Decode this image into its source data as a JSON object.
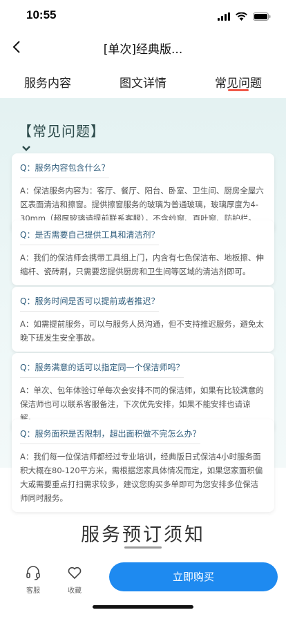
{
  "status": {
    "time": "10:55"
  },
  "nav": {
    "title": "[单次]经典版..."
  },
  "tabs": [
    {
      "label": "服务内容"
    },
    {
      "label": "图文详情"
    },
    {
      "label": "常见问题"
    }
  ],
  "section_title": "【常见问题】",
  "faqs": [
    {
      "q": "Q：服务内容包含什么？",
      "a": "A：保洁服务内容为：客厅、餐厅、阳台、卧室、卫生间、厨房全屋六区表面清洁和擦窗。提供擦窗服务的玻璃为普通玻璃，玻璃厚度为4-30mm（超厚玻璃请提前联系客服），不含纱窗、百叶窗、防护栏。"
    },
    {
      "q": "Q：是否需要自己提供工具和清洁剂？",
      "a": "A：我们的保洁师会携带工具组上门，内含有七色保洁布、地板擦、伸缩杆、瓷砖刷，只需要您提供厨房和卫生间等区域的清洁剂即可。"
    },
    {
      "q": "Q：服务时间是否可以提前或者推迟？",
      "a": "A：如需提前服务，可以与服务人员沟通，但不支持推迟服务，避免太晚下班发生安全事故。"
    },
    {
      "q": "Q：服务满意的话可以指定同一个保洁师吗？",
      "a": "A：单次、包年体验订单每次会安排不同的保洁师，如果有比较满意的保洁师也可以联系客服备注，下次优先安排，如果不能安排也请谅解。"
    },
    {
      "q": "Q：服务面积是否限制，超出面积做不完怎么办？",
      "a": "A：我们每一位保洁师都经过专业培训，经典版日式保洁4小时服务面积大概在80-120平方米，需根据您家具体情况而定，如果您家面积偏大或需要重点打扫需求较多，建议您购买多单即可为您安排多位保洁师同时服务。"
    }
  ],
  "booking_title": "服务预订须知",
  "bottom": {
    "service_label": "客服",
    "favorite_label": "收藏",
    "buy_label": "立即购买"
  },
  "colors": {
    "accent": "#1e8af0",
    "tab_underline": "#f05a4a",
    "question": "#2f5d7c"
  }
}
